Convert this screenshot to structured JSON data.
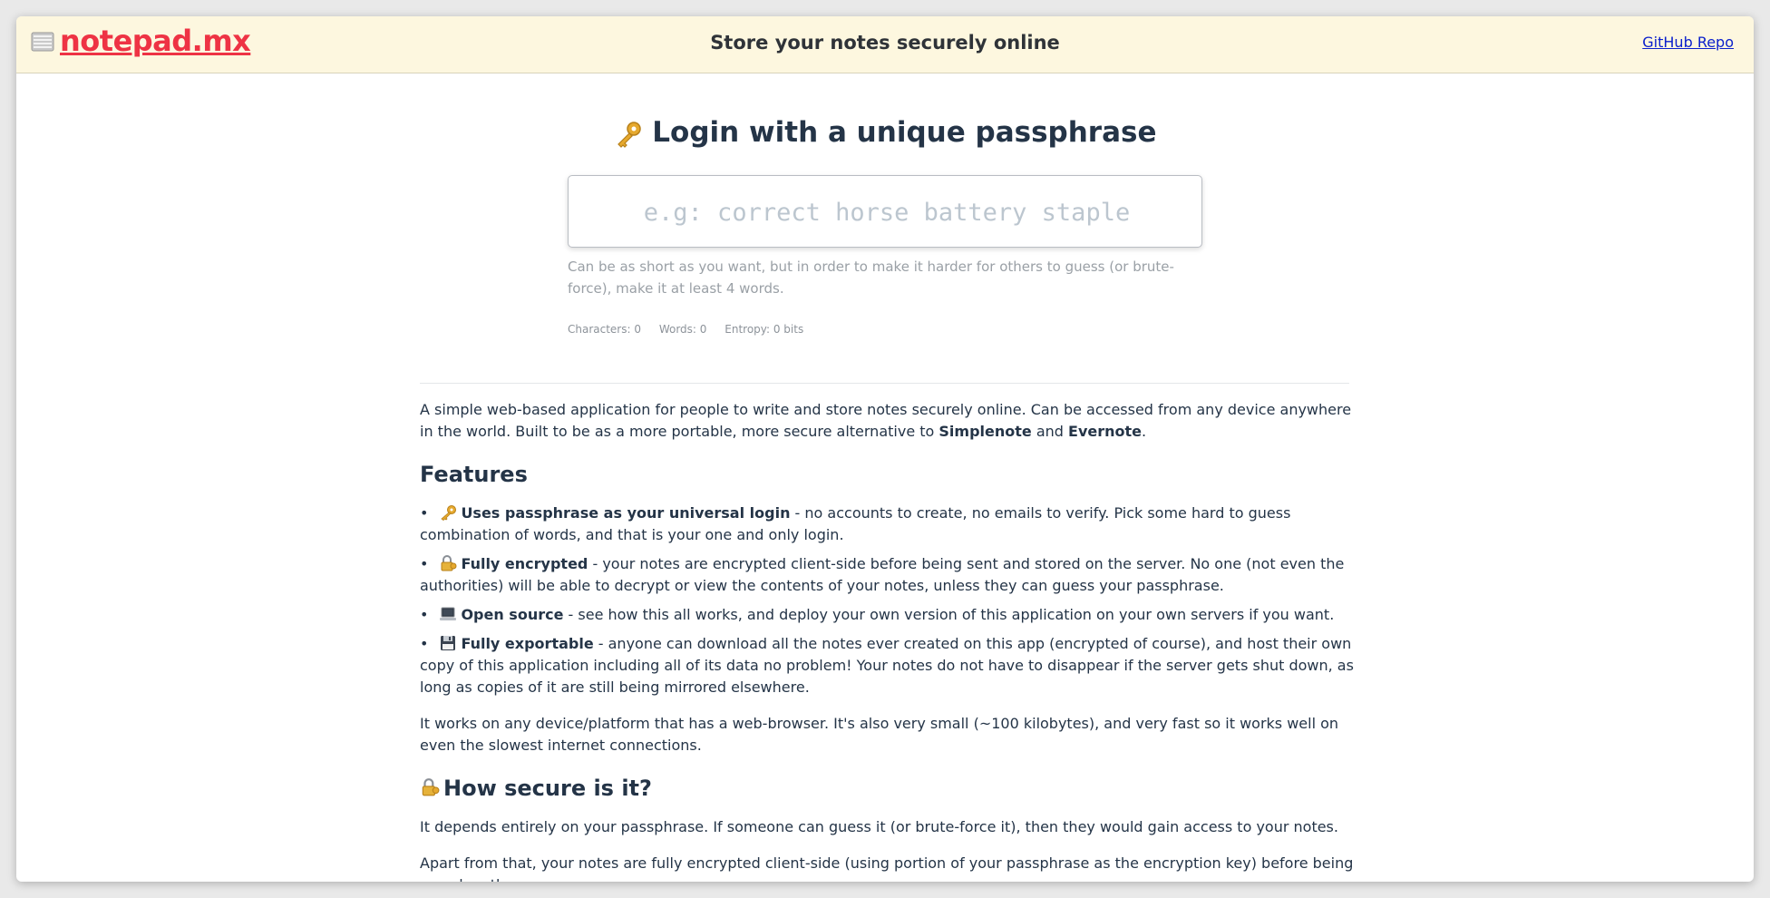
{
  "header": {
    "brand": "notepad.mx",
    "tagline": "Store your notes securely online",
    "github_link": "GitHub Repo"
  },
  "login": {
    "title": "Login with a unique passphrase",
    "placeholder": "e.g: correct horse battery staple",
    "hint": "Can be as short as you want, but in order to make it harder for others to guess (or brute-force), make it at least 4 words.",
    "stats": {
      "characters": "Characters: 0",
      "words": "Words: 0",
      "entropy": "Entropy: 0 bits"
    }
  },
  "content": {
    "intro_a": "A simple web-based application for people to write and store notes securely online. Can be accessed from any device anywhere in the world. Built to be as a more portable, more secure alternative to ",
    "intro_simplenote": "Simplenote",
    "intro_and": " and ",
    "intro_evernote": "Evernote",
    "intro_end": ".",
    "features_heading": "Features",
    "features": [
      {
        "bullet": "•",
        "icon": "key-icon",
        "title": "Uses passphrase as your universal login",
        "text": " - no accounts to create, no emails to verify. Pick some hard to guess combination of words, and that is your one and only login."
      },
      {
        "bullet": "•",
        "icon": "lock-with-key-icon",
        "title": "Fully encrypted",
        "text": " - your notes are encrypted client-side before being sent and stored on the server. No one (not even the authorities) will be able to decrypt or view the contents of your notes, unless they can guess your passphrase."
      },
      {
        "bullet": "•",
        "icon": "laptop-icon",
        "title": "Open source",
        "text": " - see how this all works, and deploy your own version of this application on your own servers if you want."
      },
      {
        "bullet": "•",
        "icon": "floppy-disk-icon",
        "title": "Fully exportable",
        "text": " - anyone can download all the notes ever created on this app (encrypted of course), and host their own copy of this application including all of its data no problem! Your notes do not have to disappear if the server gets shut down, as long as copies of it are still being mirrored elsewhere."
      }
    ],
    "devices_paragraph": "It works on any device/platform that has a web-browser. It's also very small (~100 kilobytes), and very fast so it works well on even the slowest internet connections.",
    "secure_heading": "How secure is it?",
    "secure_p1": "It depends entirely on your passphrase. If someone can guess it (or brute-force it), then they would gain access to your notes.",
    "secure_p2": "Apart from that, your notes are fully encrypted client-side (using portion of your passphrase as the encryption key) before being saved on the"
  },
  "colors": {
    "header_bg": "#fdf7df",
    "brand": "#ee3344",
    "link": "#0b20cc",
    "heading": "#243447"
  }
}
